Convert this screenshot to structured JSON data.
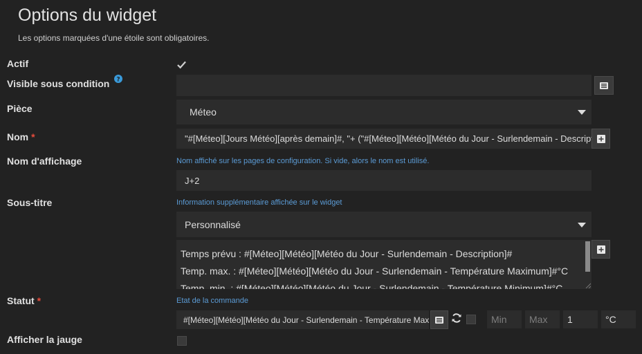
{
  "header": {
    "title": "Options du widget",
    "subtitle": "Les options marquées d'une étoile sont obligatoires."
  },
  "fields": {
    "actif": {
      "label": "Actif",
      "checked": true
    },
    "visible": {
      "label": "Visible sous condition",
      "help_icon": "?",
      "value": ""
    },
    "piece": {
      "label": "Pièce",
      "selected": "Méteo"
    },
    "nom": {
      "label": "Nom",
      "required": "*",
      "value": "\"#[Méteo][Jours Météo][après demain]#, \"+ (\"#[Méteo][Météo][Météo du Jour - Surlendemain - Description]#\")"
    },
    "nom_affichage": {
      "label": "Nom d'affichage",
      "hint": "Nom affiché sur les pages de configuration. Si vide, alors le nom est utilisé.",
      "value": "J+2"
    },
    "sous_titre": {
      "label": "Sous-titre",
      "hint": "Information supplémentaire affichée sur le widget",
      "selected": "Personnalisé",
      "lines": [
        "Temps prévu : #[Méteo][Météo][Météo du Jour - Surlendemain - Description]#",
        "Temp. max. : #[Méteo][Météo][Météo du Jour - Surlendemain - Température Maximum]#°C",
        "Temp. min. : #[Méteo][Météo][Météo du Jour - Surlendemain - Température Minimum]#°C"
      ]
    },
    "statut": {
      "label": "Statut",
      "required": "*",
      "hint": "Etat de la commande",
      "value": "#[Méteo][Météo][Météo du Jour - Surlendemain - Température Maximum]#",
      "min_placeholder": "Min",
      "max_placeholder": "Max",
      "decimals": "1",
      "unit": "°C"
    },
    "jauge": {
      "label": "Afficher la jauge",
      "checked": false
    }
  },
  "icons": {
    "list": "list-icon",
    "plus": "plus-icon",
    "refresh": "refresh-icon",
    "check": "check-icon",
    "help": "question-circle-icon"
  },
  "colors": {
    "background": "#222222",
    "field": "#2c2c2c",
    "hint": "#5b9bd5",
    "required": "#e74c3c",
    "help": "#3a9ad9"
  }
}
